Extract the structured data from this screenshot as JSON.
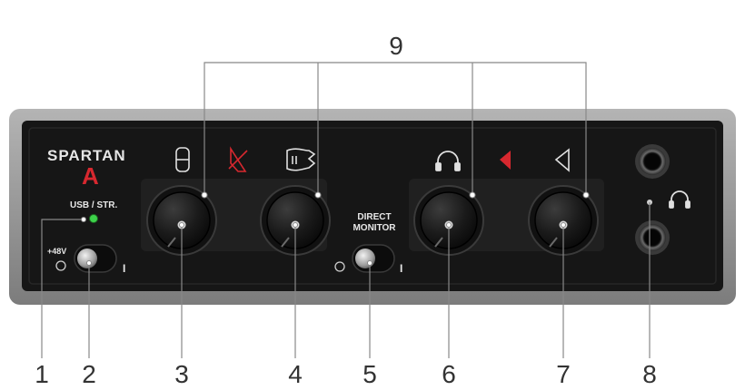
{
  "device": {
    "brand": "SPARTAN",
    "model": "A",
    "usb_label": "USB / STR.",
    "phantom_label": "+48V",
    "switch_on_mark": "I",
    "direct_monitor_line1": "DIRECT",
    "direct_monitor_line2": "MONITOR",
    "direct_switch_on_mark": "I"
  },
  "callouts": {
    "c1": "1",
    "c2": "2",
    "c3": "3",
    "c4": "4",
    "c5": "5",
    "c6": "6",
    "c7": "7",
    "c8": "8",
    "c9": "9"
  },
  "icons": [
    "microphone-icon",
    "mic-mute-icon",
    "guitar-icon",
    "headphones-icon",
    "speaker-muted-icon",
    "speaker-icon",
    "headphones-jack-icon"
  ],
  "colors": {
    "accent_red": "#d7282f",
    "led_green": "#3dd24a",
    "panel": "#161616",
    "frame": "#9a9a9a"
  }
}
